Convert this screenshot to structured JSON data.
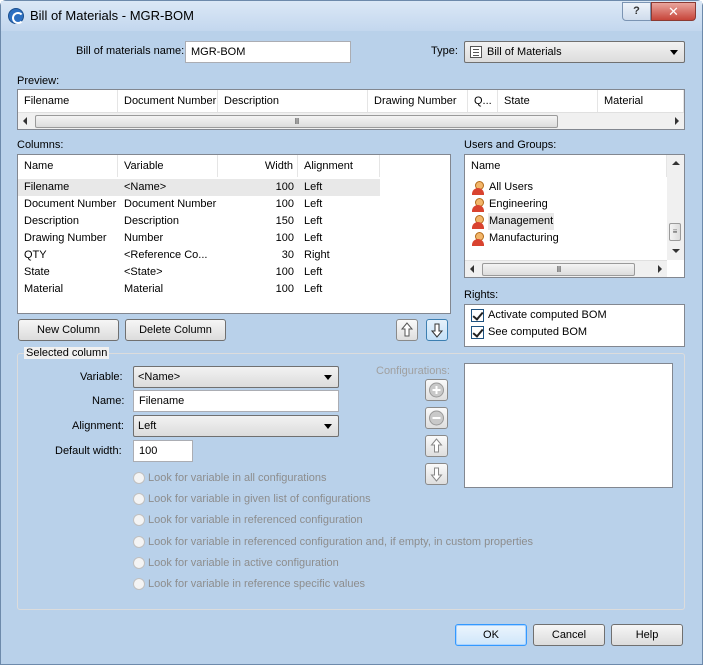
{
  "window": {
    "title": "Bill of Materials - MGR-BOM",
    "help_glyph": "?",
    "close_glyph": "✕"
  },
  "bom_name": {
    "label": "Bill of materials name:",
    "value": "MGR-BOM"
  },
  "type": {
    "label": "Type:",
    "value": "Bill of Materials"
  },
  "preview": {
    "label": "Preview:",
    "headers": [
      "Filename",
      "Document Number",
      "Description",
      "Drawing Number",
      "Q...",
      "State",
      "Material"
    ],
    "scroll_grip": "III"
  },
  "columns": {
    "label": "Columns:",
    "headers": [
      "Name",
      "Variable",
      "Width",
      "Alignment"
    ],
    "rows": [
      {
        "name": "Filename",
        "variable": "<Name>",
        "width": "100",
        "alignment": "Left"
      },
      {
        "name": "Document Number",
        "variable": "Document Number",
        "width": "100",
        "alignment": "Left"
      },
      {
        "name": "Description",
        "variable": "Description",
        "width": "150",
        "alignment": "Left"
      },
      {
        "name": "Drawing Number",
        "variable": "Number",
        "width": "100",
        "alignment": "Left"
      },
      {
        "name": "QTY",
        "variable": "<Reference Co...",
        "width": "30",
        "alignment": "Right"
      },
      {
        "name": "State",
        "variable": "<State>",
        "width": "100",
        "alignment": "Left"
      },
      {
        "name": "Material",
        "variable": "Material",
        "width": "100",
        "alignment": "Left"
      }
    ],
    "new_label": "New Column",
    "delete_label": "Delete Column"
  },
  "users": {
    "label": "Users and Groups:",
    "header": "Name",
    "items": [
      "All Users",
      "Engineering",
      "Management",
      "Manufacturing"
    ],
    "scroll_grip": "III"
  },
  "rights": {
    "label": "Rights:",
    "items": [
      {
        "label": "Activate computed BOM",
        "checked": true
      },
      {
        "label": "See computed BOM",
        "checked": true
      }
    ]
  },
  "selected": {
    "label": "Selected column",
    "variable_label": "Variable:",
    "variable_value": "<Name>",
    "name_label": "Name:",
    "name_value": "Filename",
    "alignment_label": "Alignment:",
    "alignment_value": "Left",
    "width_label": "Default width:",
    "width_value": "100",
    "configurations_label": "Configurations:",
    "options": [
      "Look for variable in all configurations",
      "Look for variable in given list of configurations",
      "Look for variable in referenced configuration",
      "Look for variable in referenced configuration and, if empty, in custom properties",
      "Look for variable in active configuration",
      "Look for variable in reference specific values"
    ]
  },
  "footer": {
    "ok": "OK",
    "cancel": "Cancel",
    "help": "Help"
  }
}
